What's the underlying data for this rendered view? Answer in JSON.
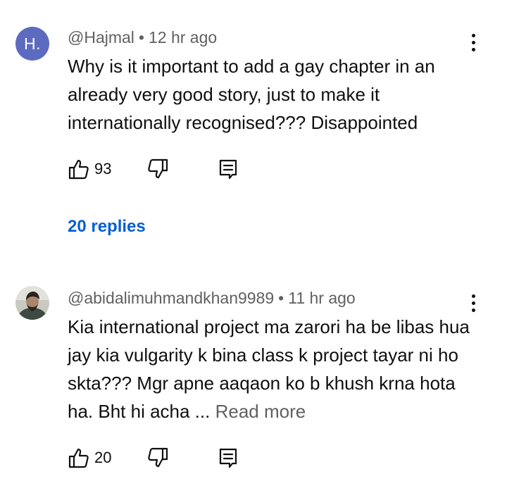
{
  "comments": [
    {
      "avatar_letter": "H.",
      "avatar_color": "#5c6bc0",
      "author": "@Hajmal",
      "separator": "•",
      "time": "12 hr ago",
      "text": "Why is it important to add a gay chapter in an already very good story, just to make it internationally recognised??? Disappointed",
      "likes": "93",
      "replies_label": "20 replies",
      "icons": [
        "more-vert-icon",
        "thumbs-up-icon",
        "thumbs-down-icon",
        "reply-icon"
      ]
    },
    {
      "author": "@abidalimuhmandkhan9989",
      "separator": "•",
      "time": "11 hr ago",
      "text": "Kia international project ma zarori ha be libas hua jay kia vulgarity k bina class k project tayar ni ho skta??? Mgr apne aaqaon ko b khush krna hota ha. Bht hi acha ...",
      "read_more": "Read more",
      "likes": "20",
      "icons": [
        "more-vert-icon",
        "thumbs-up-icon",
        "thumbs-down-icon",
        "reply-icon"
      ]
    }
  ],
  "colors": {
    "text": "#0f0f0f",
    "meta": "#606060",
    "link": "#065fd4",
    "background": "#ffffff"
  }
}
